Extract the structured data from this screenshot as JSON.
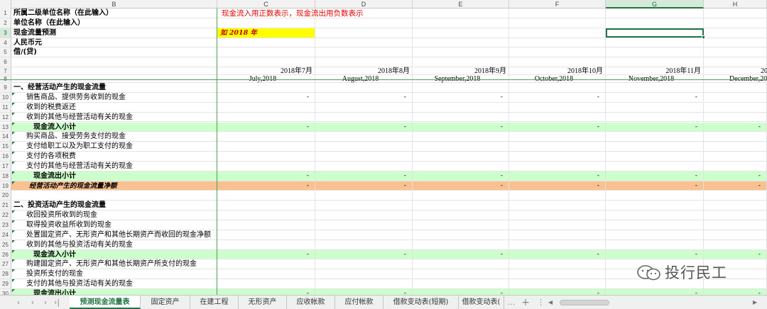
{
  "sheet": {
    "columns": [
      "B",
      "C",
      "D",
      "E",
      "F",
      "G",
      "H"
    ],
    "selected_column": "G",
    "selected_row": "3",
    "row_numbers": [
      "1",
      "2",
      "3",
      "4",
      "5",
      "6",
      "7",
      "8",
      "9",
      "10",
      "11",
      "12",
      "13",
      "14",
      "15",
      "16",
      "17",
      "18",
      "19",
      "20",
      "21",
      "22",
      "23",
      "24",
      "25",
      "26",
      "27",
      "28",
      "29",
      "30"
    ],
    "header_info": {
      "org_label": "所属二级单位名称（在此输入）",
      "unit_label": "单位名称（在此输入）",
      "forecast_label": "现金流量预测",
      "currency_label": "人民币元",
      "dr_cr_label": "借/(贷)",
      "sign_note": "现金流入用正数表示，现金流出用负数表示",
      "forecast_year": "如 2018 年"
    },
    "months": [
      {
        "ym": "2018年7月",
        "en": "July,2018"
      },
      {
        "ym": "2018年8月",
        "en": "August,2018"
      },
      {
        "ym": "2018年9月",
        "en": "September,2018"
      },
      {
        "ym": "2018年10月",
        "en": "October,2018"
      },
      {
        "ym": "2018年11月",
        "en": "November,2018"
      },
      {
        "ym": "20",
        "en": "December,20"
      }
    ],
    "rows": {
      "r9": "一、经营活动产生的现金流量",
      "r10": "销售商品、提供劳务收到的现金",
      "r11": "收到的税费返还",
      "r12": "收到的其他与经营活动有关的现金",
      "r13": "现金流入小计",
      "r14": "购买商品、接受劳务支付的现金",
      "r15": "支付给职工以及为职工支付的现金",
      "r16": "支付的各项税费",
      "r17": "支付的其他与经营活动有关的现金",
      "r18": "现金流出小计",
      "r19": "经营活动产生的现金流量净额",
      "r21": "二、投资活动产生的现金流量",
      "r22": "收回投资所收到的现金",
      "r23": "取得投资收益所收到的现金",
      "r24": "处置固定资产、无形资产和其他长期资产而收回的现金净额",
      "r25": "收到的其他与投资活动有关的现金",
      "r26": "现金流入小计",
      "r27": "购建固定资产、无形资产和其他长期资产所支付的现金",
      "r28": "投资所支付的现金",
      "r29": "支付的其他与投资活动有关的现金",
      "r30": "现金流出小计"
    },
    "dash": "-"
  },
  "tabs": [
    {
      "label": "预测现金流量表",
      "active": true
    },
    {
      "label": "固定资产"
    },
    {
      "label": "在建工程"
    },
    {
      "label": "无形资产"
    },
    {
      "label": "应收帐款"
    },
    {
      "label": "应付帐款"
    },
    {
      "label": "借款变动表(短期)"
    },
    {
      "label": "借款变动表("
    }
  ],
  "tabbar": {
    "ellipsis": "...",
    "add": "+",
    "more": "⋮"
  },
  "watermark": {
    "text": "投行民工"
  },
  "colors": {
    "accent": "#217346",
    "green_band": "#ccffcc",
    "orange_band": "#fac090",
    "highlight_yellow": "#ffff00",
    "note_red": "#e00000"
  }
}
